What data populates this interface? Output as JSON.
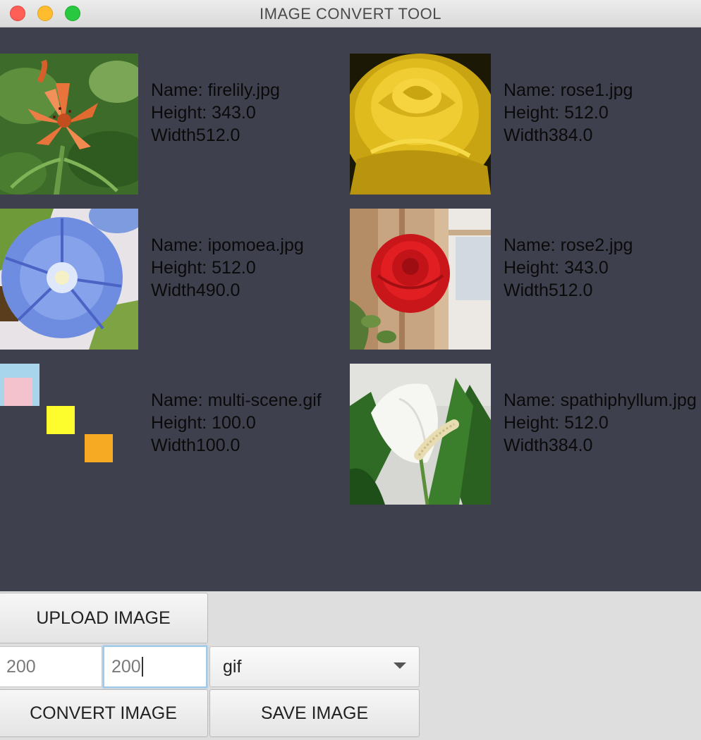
{
  "window": {
    "title": "IMAGE CONVERT TOOL"
  },
  "images": [
    {
      "name_text": "Name: firelily.jpg",
      "height_text": "Height: 343.0",
      "width_text": "Width512.0",
      "thumb_icon": "lily-flower-image"
    },
    {
      "name_text": "Name: rose1.jpg",
      "height_text": "Height: 512.0",
      "width_text": "Width384.0",
      "thumb_icon": "yellow-rose-image"
    },
    {
      "name_text": "Name: ipomoea.jpg",
      "height_text": "Height: 512.0",
      "width_text": "Width490.0",
      "thumb_icon": "morning-glory-image"
    },
    {
      "name_text": "Name: rose2.jpg",
      "height_text": "Height: 343.0",
      "width_text": "Width512.0",
      "thumb_icon": "red-rose-image"
    },
    {
      "name_text": "Name: multi-scene.gif",
      "height_text": "Height: 100.0",
      "width_text": "Width100.0",
      "thumb_icon": "colored-squares-image"
    },
    {
      "name_text": "Name: spathiphyllum.jpg",
      "height_text": "Height: 512.0",
      "width_text": "Width384.0",
      "thumb_icon": "peace-lily-image"
    }
  ],
  "controls": {
    "upload_label": "UPLOAD IMAGE",
    "width_value": "200",
    "height_value": "200",
    "format_selected": "gif",
    "convert_label": "CONVERT IMAGE",
    "save_label": "SAVE IMAGE"
  },
  "colors": {
    "panel_bg": "#3f404e",
    "close": "#ff5f57",
    "minimize": "#febc2e",
    "maximize": "#28c840"
  }
}
